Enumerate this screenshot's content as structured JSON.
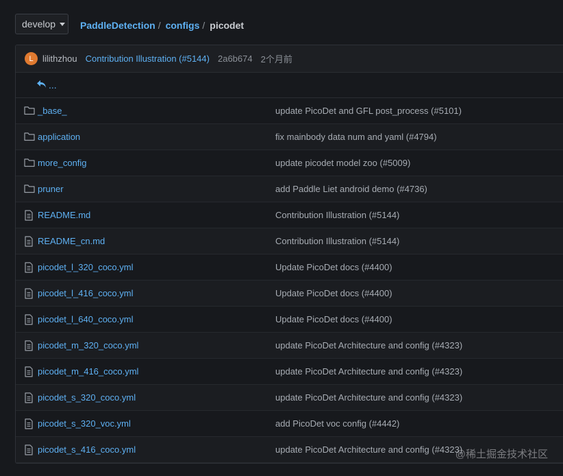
{
  "branch": {
    "label": "develop"
  },
  "breadcrumb": {
    "items": [
      "PaddleDetection",
      "configs"
    ],
    "separator": "/",
    "current": "picodet"
  },
  "commit": {
    "avatar_letter": "L",
    "author": "lilithzhou",
    "message": "Contribution Illustration (#5144)",
    "sha": "2a6b674",
    "age": "2个月前"
  },
  "parent_link": "...",
  "files": [
    {
      "type": "folder",
      "name": "_base_",
      "commit": "update PicoDet and GFL post_process (#5101)"
    },
    {
      "type": "folder",
      "name": "application",
      "commit": "fix mainbody data num and yaml (#4794)"
    },
    {
      "type": "folder",
      "name": "more_config",
      "commit": "update picodet model zoo (#5009)"
    },
    {
      "type": "folder",
      "name": "pruner",
      "commit": "add Paddle Liet android demo (#4736)"
    },
    {
      "type": "file",
      "name": "README.md",
      "commit": "Contribution Illustration (#5144)"
    },
    {
      "type": "file",
      "name": "README_cn.md",
      "commit": "Contribution Illustration (#5144)"
    },
    {
      "type": "file",
      "name": "picodet_l_320_coco.yml",
      "commit": "Update PicoDet docs (#4400)"
    },
    {
      "type": "file",
      "name": "picodet_l_416_coco.yml",
      "commit": "Update PicoDet docs (#4400)"
    },
    {
      "type": "file",
      "name": "picodet_l_640_coco.yml",
      "commit": "Update PicoDet docs (#4400)"
    },
    {
      "type": "file",
      "name": "picodet_m_320_coco.yml",
      "commit": "update PicoDet Architecture and config (#4323)"
    },
    {
      "type": "file",
      "name": "picodet_m_416_coco.yml",
      "commit": "update PicoDet Architecture and config (#4323)"
    },
    {
      "type": "file",
      "name": "picodet_s_320_coco.yml",
      "commit": "update PicoDet Architecture and config (#4323)"
    },
    {
      "type": "file",
      "name": "picodet_s_320_voc.yml",
      "commit": "add PicoDet voc config (#4442)"
    },
    {
      "type": "file",
      "name": "picodet_s_416_coco.yml",
      "commit": "update PicoDet Architecture and config (#4323)"
    }
  ],
  "watermark": "@稀土掘金技术社区",
  "colors": {
    "background": "#17191d",
    "link": "#5eb0f2",
    "avatar": "#e07a30"
  }
}
